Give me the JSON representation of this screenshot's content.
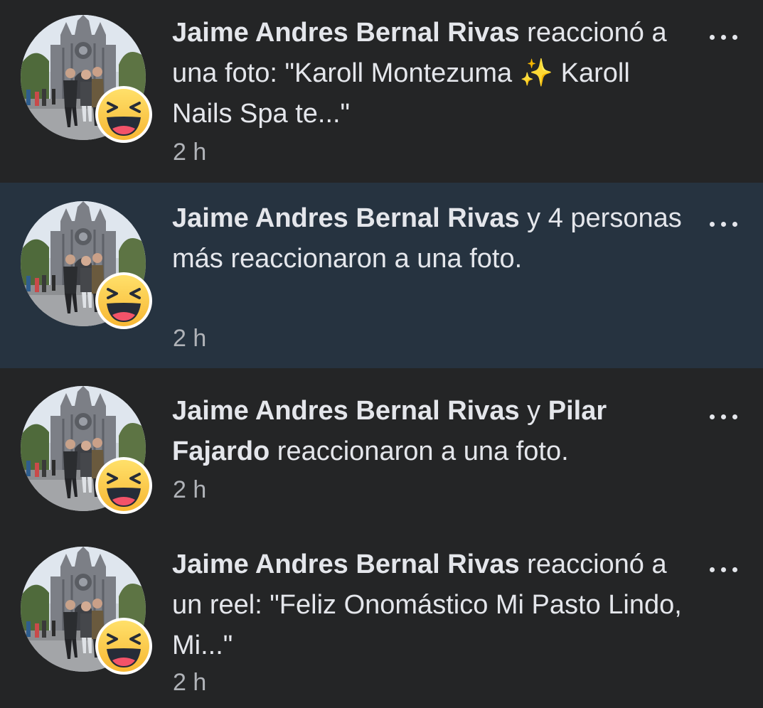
{
  "notifications": [
    {
      "actor": "Jaime Andres Bernal Rivas",
      "action": " reaccionó a una foto: \"Karoll Montezuma ✨ Karoll Nails Spa te...\"",
      "time": "2 h",
      "unread": false,
      "reaction_icon": "haha-emoji-icon",
      "menu_icon": "more-options-icon"
    },
    {
      "actor": "Jaime Andres Bernal Rivas",
      "action": " y 4 personas más reaccionaron a una foto.",
      "time": "2 h",
      "unread": true,
      "reaction_icon": "haha-emoji-icon",
      "menu_icon": "more-options-icon"
    },
    {
      "actor": "Jaime Andres Bernal Rivas",
      "connector": " y ",
      "actor2": "Pilar Fajardo",
      "action": " reaccionaron a una foto.",
      "time": "2 h",
      "unread": false,
      "reaction_icon": "haha-emoji-icon",
      "menu_icon": "more-options-icon"
    },
    {
      "actor": "Jaime Andres Bernal Rivas",
      "action": " reaccionó a un reel: \"Feliz Onomástico Mi Pasto Lindo, Mi...\"",
      "time": "2 h",
      "unread": false,
      "reaction_icon": "haha-emoji-icon",
      "menu_icon": "more-options-icon"
    }
  ],
  "colors": {
    "background": "#242526",
    "unread_background": "#263340",
    "primary_text": "#e4e6eb",
    "secondary_text": "#b0b3b8"
  }
}
